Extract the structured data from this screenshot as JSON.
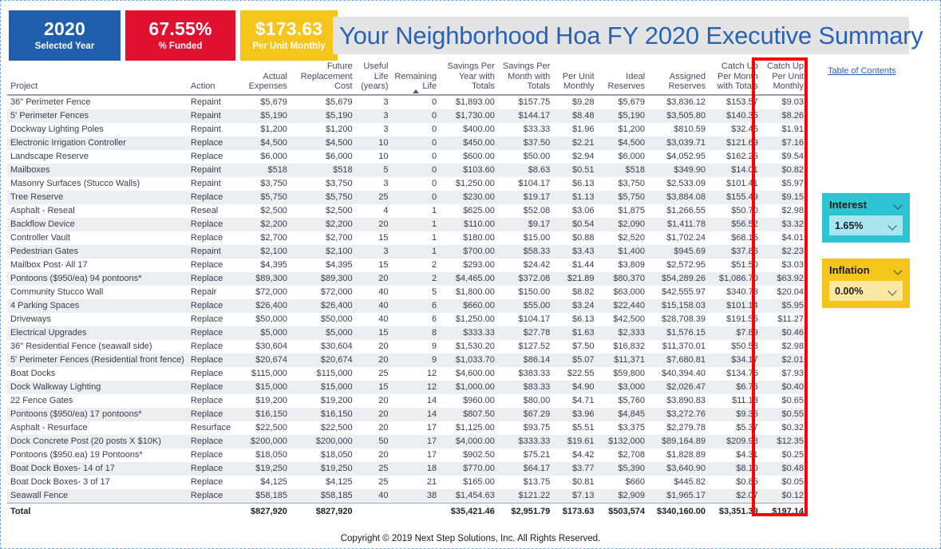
{
  "kpis": [
    {
      "value": "2020",
      "label": "Selected Year",
      "color": "#1f5fae"
    },
    {
      "value": "67.55%",
      "label": "% Funded",
      "color": "#e0102f"
    },
    {
      "value": "$173.63",
      "label": "Per Unit Monthly",
      "color": "#f5c51b"
    }
  ],
  "header": {
    "title": "Your Neighborhood Hoa FY 2020 Executive Summary",
    "toc_link": "Table of Contents"
  },
  "table": {
    "columns": [
      "Project",
      "Action",
      "Actual Expenses",
      "Future Replacement Cost",
      "Useful Life (years)",
      "Remaining Life",
      "Savings Per Year with Totals",
      "Savings Per Month with Totals",
      "Per Unit Monthly",
      "Ideal Reserves",
      "Assigned Reserves",
      "Catch Up Per Month with Totals",
      "Catch Up Per Unit Monthly"
    ],
    "sorted_column": "Remaining Life",
    "sort_direction": "ascending",
    "rows": [
      [
        "36\" Perimeter Fence",
        "Repaint",
        "$5,679",
        "$5,679",
        "3",
        "0",
        "$1,893.00",
        "$157.75",
        "$9.28",
        "$5,679",
        "$3,836.12",
        "$153.57",
        "$9.03"
      ],
      [
        "5' Perimeter Fences",
        "Repaint",
        "$5,190",
        "$5,190",
        "3",
        "0",
        "$1,730.00",
        "$144.17",
        "$8.48",
        "$5,190",
        "$3,505.80",
        "$140.35",
        "$8.26"
      ],
      [
        "Dockway Lighting Poles",
        "Repaint",
        "$1,200",
        "$1,200",
        "3",
        "0",
        "$400.00",
        "$33.33",
        "$1.96",
        "$1,200",
        "$810.59",
        "$32.45",
        "$1.91"
      ],
      [
        "Electronic Irrigation Controller",
        "Replace",
        "$4,500",
        "$4,500",
        "10",
        "0",
        "$450.00",
        "$37.50",
        "$2.21",
        "$4,500",
        "$3,039.71",
        "$121.69",
        "$7.16"
      ],
      [
        "Landscape Reserve",
        "Replace",
        "$6,000",
        "$6,000",
        "10",
        "0",
        "$600.00",
        "$50.00",
        "$2.94",
        "$6,000",
        "$4,052.95",
        "$162.25",
        "$9.54"
      ],
      [
        "Mailboxes",
        "Repaint",
        "$518",
        "$518",
        "5",
        "0",
        "$103.60",
        "$8.63",
        "$0.51",
        "$518",
        "$349.90",
        "$14.01",
        "$0.82"
      ],
      [
        "Masonry Surfaces (Stucco Walls)",
        "Repaint",
        "$3,750",
        "$3,750",
        "3",
        "0",
        "$1,250.00",
        "$104.17",
        "$6.13",
        "$3,750",
        "$2,533.09",
        "$101.41",
        "$5.97"
      ],
      [
        "Tree Reserve",
        "Replace",
        "$5,750",
        "$5,750",
        "25",
        "0",
        "$230.00",
        "$19.17",
        "$1.13",
        "$5,750",
        "$3,884.08",
        "$155.49",
        "$9.15"
      ],
      [
        "Asphalt - Reseal",
        "Reseal",
        "$2,500",
        "$2,500",
        "4",
        "1",
        "$625.00",
        "$52.08",
        "$3.06",
        "$1,875",
        "$1,266.55",
        "$50.70",
        "$2.98"
      ],
      [
        "Backflow Device",
        "Replace",
        "$2,200",
        "$2,200",
        "20",
        "1",
        "$110.00",
        "$9.17",
        "$0.54",
        "$2,090",
        "$1,411.78",
        "$56.52",
        "$3.32"
      ],
      [
        "Controller Vault",
        "Replace",
        "$2,700",
        "$2,700",
        "15",
        "1",
        "$180.00",
        "$15.00",
        "$0.88",
        "$2,520",
        "$1,702.24",
        "$68.15",
        "$4.01"
      ],
      [
        "Pedestrian Gates",
        "Repaint",
        "$2,100",
        "$2,100",
        "3",
        "1",
        "$700.00",
        "$58.33",
        "$3.43",
        "$1,400",
        "$945.69",
        "$37.86",
        "$2.23"
      ],
      [
        "Mailbox Post- All 17",
        "Replace",
        "$4,395",
        "$4,395",
        "15",
        "2",
        "$293.00",
        "$24.42",
        "$1.44",
        "$3,809",
        "$2,572.95",
        "$51.50",
        "$3.03"
      ],
      [
        "Pontoons ($950/ea) 94 pontoons*",
        "Replace",
        "$89,300",
        "$89,300",
        "20",
        "2",
        "$4,465.00",
        "$372.08",
        "$21.89",
        "$80,370",
        "$54,289.26",
        "$1,086.70",
        "$63.92"
      ],
      [
        "Community Stucco Wall",
        "Repair",
        "$72,000",
        "$72,000",
        "40",
        "5",
        "$1,800.00",
        "$150.00",
        "$8.82",
        "$63,000",
        "$42,555.97",
        "$340.73",
        "$20.04"
      ],
      [
        "4 Parking Spaces",
        "Replace",
        "$26,400",
        "$26,400",
        "40",
        "6",
        "$660.00",
        "$55.00",
        "$3.24",
        "$22,440",
        "$15,158.03",
        "$101.14",
        "$5.95"
      ],
      [
        "Driveways",
        "Replace",
        "$50,000",
        "$50,000",
        "40",
        "6",
        "$1,250.00",
        "$104.17",
        "$6.13",
        "$42,500",
        "$28,708.39",
        "$191.55",
        "$11.27"
      ],
      [
        "Electrical Upgrades",
        "Replace",
        "$5,000",
        "$5,000",
        "15",
        "8",
        "$333.33",
        "$27.78",
        "$1.63",
        "$2,333",
        "$1,576.15",
        "$7.89",
        "$0.46"
      ],
      [
        "36\" Residential Fence (seawall side)",
        "Replace",
        "$30,604",
        "$30,604",
        "20",
        "9",
        "$1,530.20",
        "$127.52",
        "$7.50",
        "$16,832",
        "$11,370.01",
        "$50.58",
        "$2.98"
      ],
      [
        "5' Perimeter Fences (Residential front fence)",
        "Replace",
        "$20,674",
        "$20,674",
        "20",
        "9",
        "$1,033.70",
        "$86.14",
        "$5.07",
        "$11,371",
        "$7,680.81",
        "$34.17",
        "$2.01"
      ],
      [
        "Boat Docks",
        "Replace",
        "$115,000",
        "$115,000",
        "25",
        "12",
        "$4,600.00",
        "$383.33",
        "$22.55",
        "$59,800",
        "$40,394.40",
        "$134.76",
        "$7.93"
      ],
      [
        "Dock Walkway Lighting",
        "Replace",
        "$15,000",
        "$15,000",
        "15",
        "12",
        "$1,000.00",
        "$83.33",
        "$4.90",
        "$3,000",
        "$2,026.47",
        "$6.76",
        "$0.40"
      ],
      [
        "22 Fence Gates",
        "Replace",
        "$19,200",
        "$19,200",
        "20",
        "14",
        "$960.00",
        "$80.00",
        "$4.71",
        "$5,760",
        "$3,890.83",
        "$11.13",
        "$0.65"
      ],
      [
        "Pontoons ($950/ea) 17 pontoons*",
        "Replace",
        "$16,150",
        "$16,150",
        "20",
        "14",
        "$807.50",
        "$67.29",
        "$3.96",
        "$4,845",
        "$3,272.76",
        "$9.36",
        "$0.55"
      ],
      [
        "Asphalt - Resurface",
        "Resurface",
        "$22,500",
        "$22,500",
        "20",
        "17",
        "$1,125.00",
        "$93.75",
        "$5.51",
        "$3,375",
        "$2,279.78",
        "$5.37",
        "$0.32"
      ],
      [
        "Dock Concrete Post (20 posts X $10K)",
        "Replace",
        "$200,000",
        "$200,000",
        "50",
        "17",
        "$4,000.00",
        "$333.33",
        "$19.61",
        "$132,000",
        "$89,164.89",
        "$209.98",
        "$12.35"
      ],
      [
        "Pontoons ($950.ea) 19 Pontoons*",
        "Replace",
        "$18,050",
        "$18,050",
        "20",
        "17",
        "$902.50",
        "$75.21",
        "$4.42",
        "$2,708",
        "$1,828.89",
        "$4.31",
        "$0.25"
      ],
      [
        "Boat Dock Boxes- 14 of 17",
        "Replace",
        "$19,250",
        "$19,250",
        "25",
        "18",
        "$770.00",
        "$64.17",
        "$3.77",
        "$5,390",
        "$3,640.90",
        "$8.10",
        "$0.48"
      ],
      [
        "Boat Dock Boxes- 3 of 17",
        "Replace",
        "$4,125",
        "$4,125",
        "25",
        "21",
        "$165.00",
        "$13.75",
        "$0.81",
        "$660",
        "$445.82",
        "$0.85",
        "$0.05"
      ],
      [
        "Seawall Fence",
        "Replace",
        "$58,185",
        "$58,185",
        "40",
        "38",
        "$1,454.63",
        "$121.22",
        "$7.13",
        "$2,909",
        "$1,965.17",
        "$2.07",
        "$0.12"
      ]
    ],
    "total_row": [
      "Total",
      "",
      "$827,920",
      "$827,920",
      "",
      "",
      "$35,421.46",
      "$2,951.79",
      "$173.63",
      "$503,574",
      "$340,160.00",
      "$3,351.39",
      "$197.14"
    ]
  },
  "highlight": {
    "color": "#ff0000",
    "target_column": "Catch Up Per Unit Monthly"
  },
  "slicers": [
    {
      "name": "Interest",
      "value": "1.65%",
      "header_color": "#2ec4d4",
      "field_color": "#a8e7ef"
    },
    {
      "name": "Inflation",
      "value": "0.00%",
      "header_color": "#f5c51b",
      "field_color": "#fbe9a3"
    }
  ],
  "footer": {
    "copyright": "Copyright © 2019 Next Step Solutions, Inc. All Rights Reserved."
  }
}
